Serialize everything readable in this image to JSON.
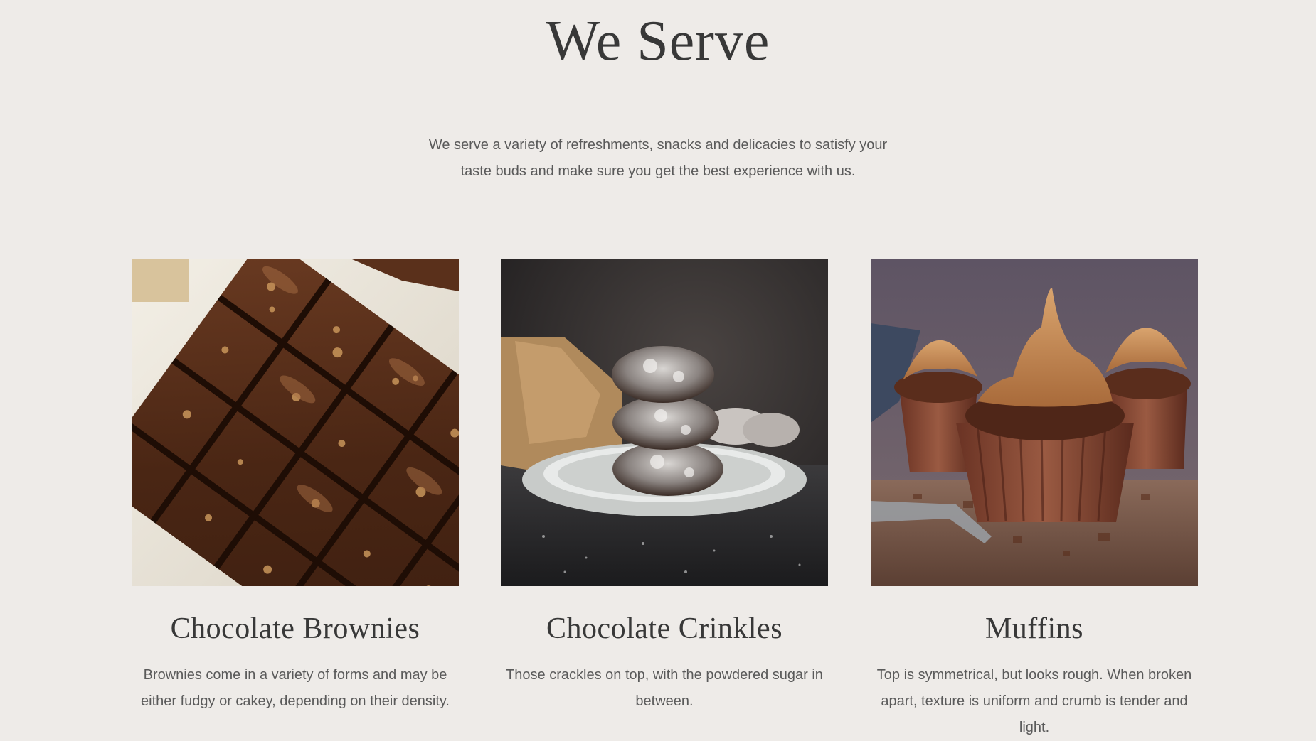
{
  "section": {
    "title": "We Serve",
    "intro": "We serve a variety of refreshments, snacks and delicacies to satisfy your taste buds and make sure you get the best experience with us."
  },
  "items": [
    {
      "name": "Chocolate Brownies",
      "description": "Brownies come in a variety of forms and may be either fudgy or cakey, depending on their density."
    },
    {
      "name": "Chocolate Crinkles",
      "description": "Those crackles on top, with the powdered sugar in between."
    },
    {
      "name": "Muffins",
      "description": "Top is symmetrical, but looks rough. When broken apart, texture is uniform and crumb is tender and light."
    }
  ],
  "colors": {
    "background": "#eeebe8",
    "heading": "#383838",
    "body_text": "#5a5a5a"
  }
}
